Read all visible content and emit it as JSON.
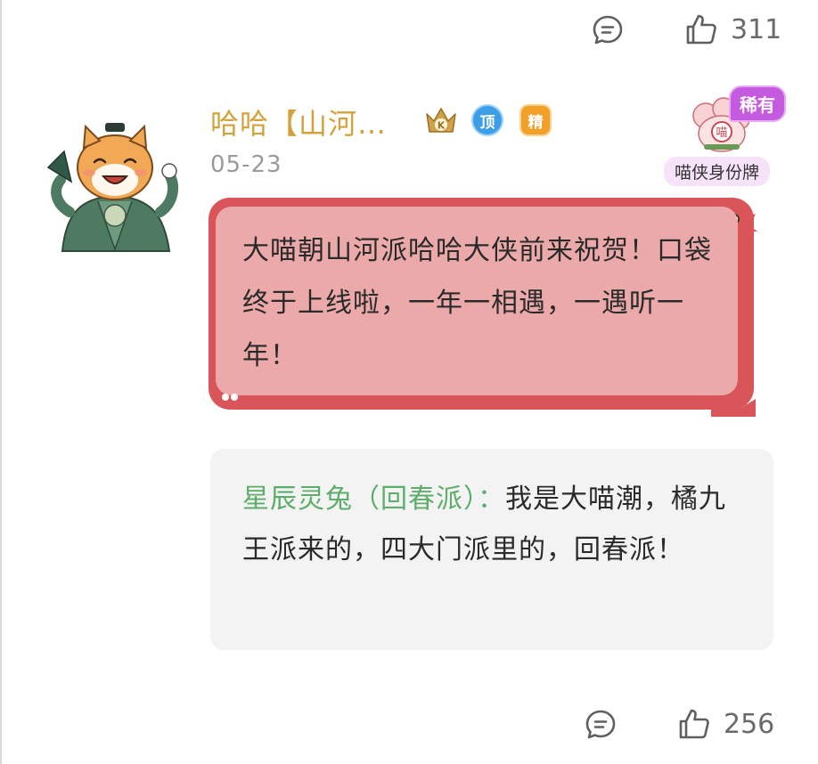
{
  "top_bar": {
    "like_count": "311"
  },
  "comment": {
    "username": "哈哈【山河…",
    "date": "05-23",
    "badges": {
      "k": "K",
      "top": "顶",
      "featured": "精"
    },
    "rare_tag": "稀有",
    "identity_card_label": "喵侠身份牌",
    "text": "大喵朝山河派哈哈大侠前来祝贺！口袋终于上线啦，一年一相遇，一遇听一年！"
  },
  "reply": {
    "author": "星辰灵兔（回春派）：",
    "text": "我是大喵潮，橘九王派来的，四大门派里的，回春派！"
  },
  "bottom_bar": {
    "like_count": "256"
  },
  "colors": {
    "username": "#d4a23c",
    "reply_author": "#5cae6a",
    "bubble_border": "#d9555a",
    "bubble_fill": "#ebaaa9",
    "rare_tag": "#c45ae0"
  },
  "icons": [
    "comment-icon",
    "thumbs-up-icon",
    "crown-icon"
  ]
}
